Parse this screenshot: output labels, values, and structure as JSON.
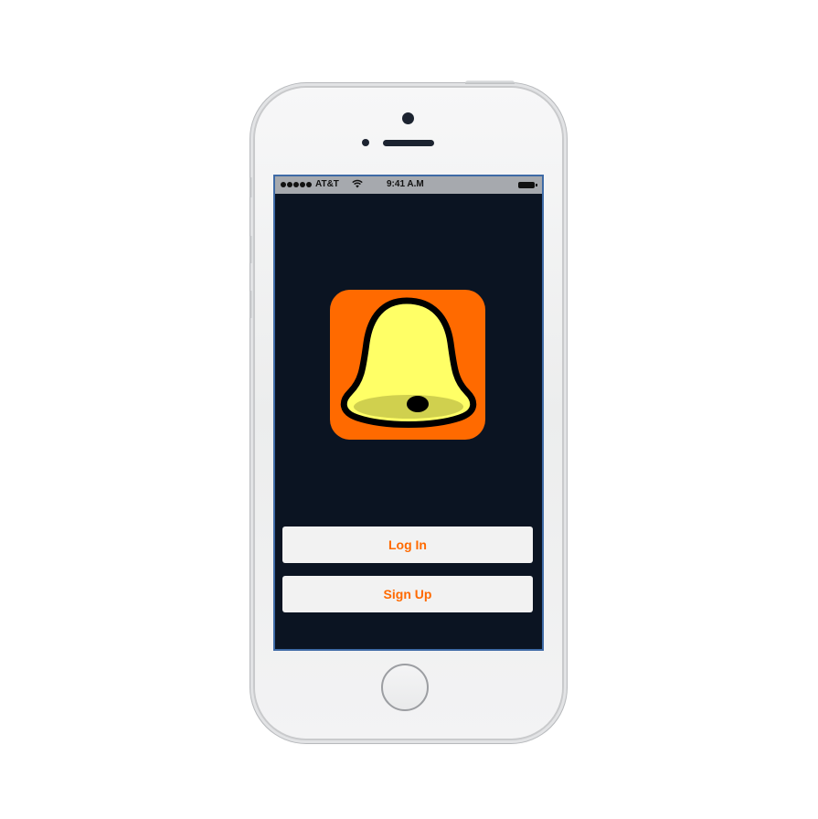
{
  "status_bar": {
    "carrier": "AT&T",
    "time": "9:41 A.M",
    "signal_bars": 5,
    "battery_icon": "battery-full-icon",
    "wifi_icon": "wifi-icon"
  },
  "app": {
    "logo_icon": "bell-icon",
    "colors": {
      "background": "#0b1422",
      "icon_background": "#ff6a00",
      "bell": "#ffff66",
      "button_text": "#ff6a00",
      "button_background": "#f2f2f2"
    }
  },
  "actions": {
    "login_label": "Log In",
    "signup_label": "Sign Up"
  }
}
